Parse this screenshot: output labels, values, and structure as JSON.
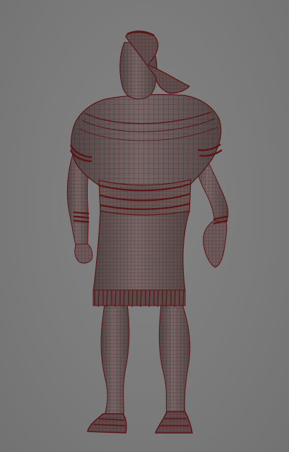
{
  "viewport": {
    "background_color": "#7a7a7a",
    "mesh_fill_color": "#6b5c5c",
    "wireframe_color": "#5a1414",
    "shading": "wireframe-on-shaded"
  },
  "model": {
    "subject": "character-figure",
    "parts": [
      "head",
      "headdress",
      "torso",
      "shoulder-bands",
      "waist-sash",
      "tunic-skirt",
      "tunic-fringe",
      "left-arm",
      "right-arm",
      "left-hand",
      "right-hand",
      "wrist-cuffs",
      "left-leg",
      "right-leg",
      "left-sandal",
      "right-sandal"
    ]
  }
}
